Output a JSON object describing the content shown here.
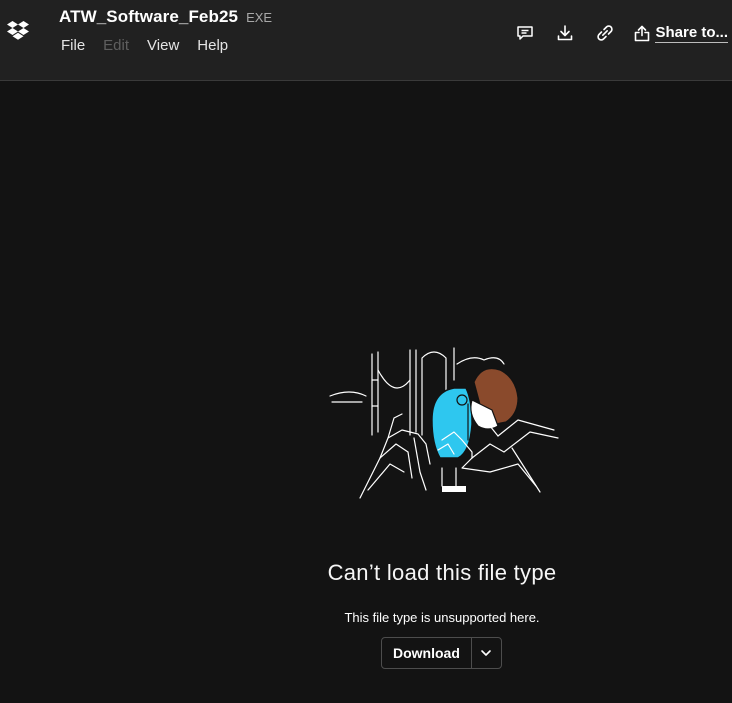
{
  "header": {
    "file_name": "ATW_Software_Feb25",
    "file_ext": "EXE",
    "menu": [
      {
        "label": "File"
      },
      {
        "label": "Edit"
      },
      {
        "label": "View"
      },
      {
        "label": "Help"
      }
    ],
    "actions": {
      "comment_icon": "comment-icon",
      "download_icon": "download-icon",
      "link_icon": "link-icon",
      "share_label": "Share to..."
    }
  },
  "main": {
    "heading": "Can’t load this file type",
    "subtext": "This file type is unsupported here.",
    "download_label": "Download",
    "illustration": "person looking through coin-operated binoculars"
  },
  "colors": {
    "background": "#131313",
    "topbar": "#212121",
    "binocular_accent": "#2ec7ef",
    "hair": "#8a4a2c"
  }
}
